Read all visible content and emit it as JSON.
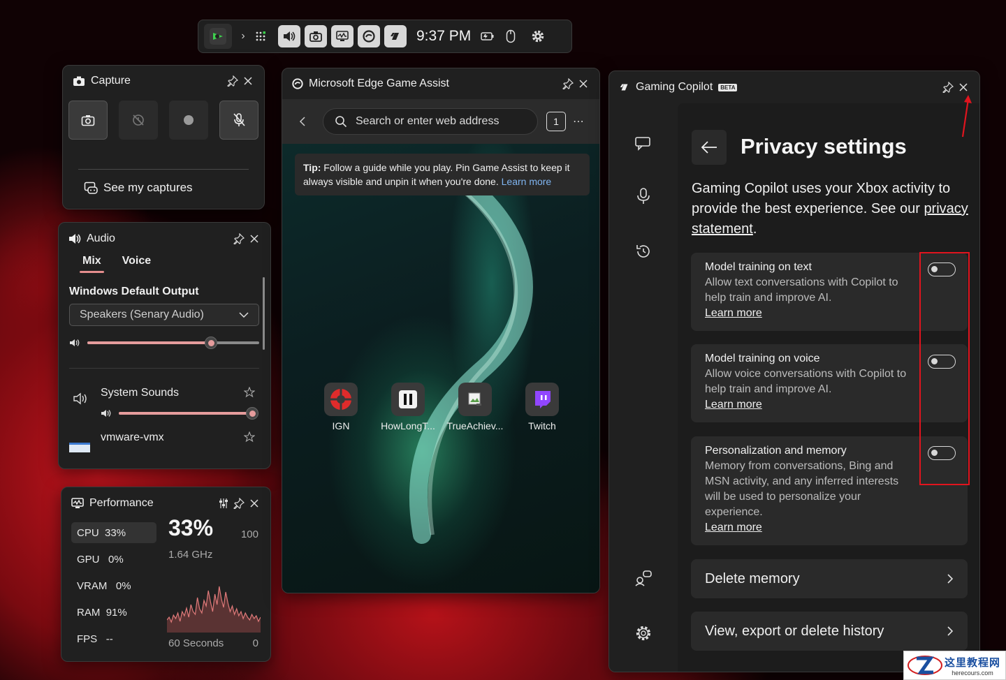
{
  "topbar": {
    "time": "9:37 PM"
  },
  "capture": {
    "title": "Capture",
    "see_captures": "See my captures"
  },
  "audio": {
    "title": "Audio",
    "tabs": [
      "Mix",
      "Voice"
    ],
    "output_label": "Windows Default Output",
    "device": "Speakers (Senary Audio)",
    "master_volume": 0.72,
    "apps": [
      {
        "name": "System Sounds",
        "volume": 0.99
      },
      {
        "name": "vmware-vmx"
      }
    ]
  },
  "performance": {
    "title": "Performance",
    "metrics": [
      {
        "label": "CPU",
        "value": "33%"
      },
      {
        "label": "GPU",
        "value": "0%"
      },
      {
        "label": "VRAM",
        "value": "0%"
      },
      {
        "label": "RAM",
        "value": "91%"
      },
      {
        "label": "FPS",
        "value": "--"
      }
    ],
    "big_value": "33%",
    "max": "100",
    "freq": "1.64 GHz",
    "range": "60 Seconds",
    "min": "0",
    "graph": [
      18,
      22,
      15,
      25,
      20,
      28,
      16,
      30,
      24,
      35,
      22,
      40,
      30,
      26,
      50,
      34,
      28,
      46,
      38,
      60,
      44,
      30,
      55,
      40,
      66,
      48,
      36,
      58,
      42,
      30,
      38,
      26,
      34,
      24,
      30,
      20,
      28,
      22,
      18,
      26,
      20,
      24,
      16,
      22
    ]
  },
  "edge": {
    "title": "Microsoft Edge Game Assist",
    "search_placeholder": "Search or enter web address",
    "tab_count": "1",
    "tip_bold": "Tip:",
    "tip_text": "Follow a guide while you play. Pin Game Assist to keep it always visible and unpin it when you're done.",
    "tip_link": "Learn more",
    "shortcuts": [
      "IGN",
      "HowLongT...",
      "TrueAchiev...",
      "Twitch"
    ]
  },
  "copilot": {
    "title": "Gaming Copilot",
    "badge": "BETA",
    "heading": "Privacy settings",
    "intro": "Gaming Copilot uses your Xbox activity to provide the best experience. See our",
    "intro_link": "privacy statement",
    "intro_end": ".",
    "settings": [
      {
        "title": "Model training on text",
        "desc": "Allow text conversations with Copilot to help train and improve AI.",
        "link": "Learn more"
      },
      {
        "title": "Model training on voice",
        "desc": "Allow voice conversations with Copilot to help train and improve AI.",
        "link": "Learn more"
      },
      {
        "title": "Personalization and memory",
        "desc": "Memory from conversations, Bing and MSN activity, and any inferred interests will be used to personalize your experience.",
        "link": "Learn more"
      }
    ],
    "delete_memory": "Delete memory",
    "view_history": "View, export or delete history"
  },
  "colors": {
    "accent_pink": "#e59c9c",
    "annotation_red": "#e0141e",
    "wallpaper_red": "#b51219"
  }
}
